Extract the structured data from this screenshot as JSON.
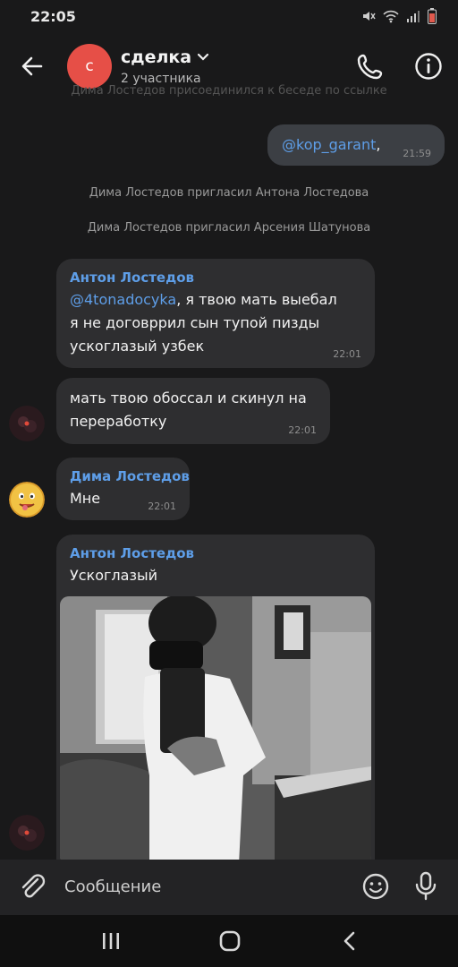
{
  "status_bar": {
    "time": "22:05"
  },
  "header": {
    "avatar_letter": "с",
    "title": "сделка",
    "subtitle": "2 участника"
  },
  "chat": {
    "faded_top_text": "Дима Лостедов присоединился к беседе по ссылке",
    "outgoing": {
      "mention": "@kop_garant",
      "suffix": ",",
      "time": "21:59"
    },
    "system_messages": [
      "Дима Лостедов пригласил Антона Лостедова",
      "Дима Лостедов пригласил Арсения Шатунова"
    ],
    "messages": [
      {
        "sender": "Антон Лостедов",
        "mention": "@4tonadocyka",
        "text_after_mention": ", я твою мать выебал",
        "lines": [
          "я не договррил сын тупой пизды",
          "ускоглазый узбек"
        ],
        "time": "22:01"
      },
      {
        "lines": [
          "мать твою обоссал и скинул на",
          "переработку"
        ],
        "time": "22:01"
      },
      {
        "sender": "Дима Лостедов",
        "text": "Мне",
        "time": "22:01"
      },
      {
        "sender": "Антон Лостедов",
        "text": "Ускоглазый"
      }
    ]
  },
  "input": {
    "placeholder": "Сообщение"
  },
  "colors": {
    "background": "#19191a",
    "bubble": "#2e2e30",
    "outgoing_bubble": "#3c3f44",
    "accent": "#5e9ee8",
    "avatar": "#e64f47"
  },
  "icons": [
    "back-arrow-icon",
    "chevron-down-icon",
    "phone-icon",
    "info-icon",
    "paperclip-icon",
    "emoji-icon",
    "microphone-icon",
    "mute-icon",
    "wifi-icon",
    "signal-icon",
    "battery-icon"
  ]
}
